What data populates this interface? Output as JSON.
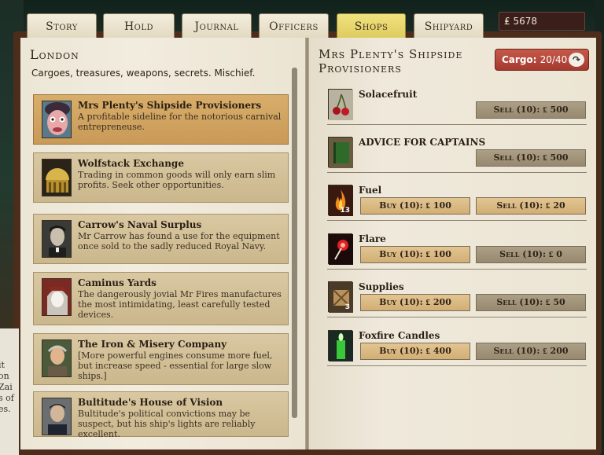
{
  "tabs": [
    {
      "label": "Story"
    },
    {
      "label": "Hold"
    },
    {
      "label": "Journal"
    },
    {
      "label": "Officers"
    },
    {
      "label": "Shops"
    },
    {
      "label": "Shipyard"
    }
  ],
  "echoes": "₤ 5678",
  "background_doc": [
    "it",
    "on",
    "",
    "Zai",
    "s of",
    "",
    "es."
  ],
  "location": {
    "title": "London",
    "subtitle": "Cargoes, treasures, weapons, secrets. Mischief."
  },
  "shops": [
    {
      "name": "Mrs Plenty's Shipside Provisioners",
      "desc": "A profitable sideline for the notorious carnival entrepreneuse."
    },
    {
      "name": "Wolfstack Exchange",
      "desc": "Trading in common goods will only earn slim profits. Seek other opportunities."
    },
    {
      "name": "Carrow's Naval Surplus",
      "desc": "Mr Carrow has found a use for the equipment once sold to the sadly reduced Royal Navy."
    },
    {
      "name": "Caminus Yards",
      "desc": "The dangerously jovial Mr Fires manufactures the most intimidating, least carefully tested devices."
    },
    {
      "name": "The Iron & Misery Company",
      "desc": "[More powerful engines consume more fuel, but increase speed - essential for large slow ships.]"
    },
    {
      "name": "Bultitude's House of Vision",
      "desc": "Bultitude's political convictions may be suspect, but his ship's lights are reliably excellent."
    }
  ],
  "shop": {
    "title": "Mrs Plenty's Shipside Provisioners",
    "cargo_label": "Cargo:",
    "cargo_value": "20/40"
  },
  "items": [
    {
      "name": "Solacefruit",
      "icon": "cherries-icon",
      "buy": "",
      "sell": "Sell (10): ₤ 500"
    },
    {
      "name": "ADVICE FOR CAPTAINS",
      "icon": "book-icon",
      "buy": "",
      "sell": "Sell (10): ₤ 500"
    },
    {
      "name": "Fuel",
      "icon": "flame-icon",
      "qty": "13",
      "buy": "Buy (10): ₤ 100",
      "sell": "Sell (10): ₤ 20"
    },
    {
      "name": "Flare",
      "icon": "flare-icon",
      "buy": "Buy (10): ₤ 100",
      "sell": "Sell (10): ₤ 0"
    },
    {
      "name": "Supplies",
      "icon": "crate-icon",
      "qty": "3",
      "buy": "Buy (10): ₤ 200",
      "sell": "Sell (10): ₤ 50"
    },
    {
      "name": "Foxfire Candles",
      "icon": "candle-icon",
      "buy": "Buy (10): ₤ 400",
      "sell": "Sell (10): ₤ 200"
    }
  ],
  "colors": {
    "active_tab": "#f1e27e",
    "selected_shop": "#d8ad6a",
    "cargo": "#b8483b"
  }
}
